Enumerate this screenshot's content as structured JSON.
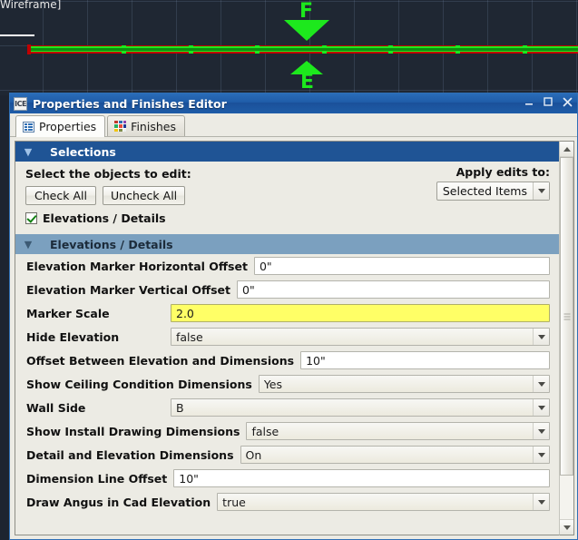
{
  "cad": {
    "status_label": "Wireframe]",
    "marker_top_letter": "F",
    "marker_bottom_letter": "E",
    "colors": {
      "background": "#1f2733",
      "grid": "#788caa",
      "wall_green": "#1de81d",
      "wall_red": "#c00000",
      "marker_green": "#1de81d"
    }
  },
  "window": {
    "app_icon_text": "ICE",
    "title": "Properties and Finishes Editor",
    "buttons": {
      "minimize": "minimize",
      "maximize": "maximize",
      "close": "close"
    },
    "accent_color": "#1f5ca8"
  },
  "tabs": [
    {
      "label": "Properties",
      "icon": "list-icon",
      "active": true
    },
    {
      "label": "Finishes",
      "icon": "color-swatch-icon",
      "active": false
    }
  ],
  "selections": {
    "header": "Selections",
    "prompt": "Select the objects to edit:",
    "check_all_label": "Check All",
    "uncheck_all_label": "Uncheck All",
    "apply_label": "Apply edits to:",
    "apply_value": "Selected Items",
    "checkbox": {
      "label": "Elevations / Details",
      "checked": true
    }
  },
  "elevations_section": {
    "header": "Elevations / Details"
  },
  "properties": [
    {
      "label": "Elevation Marker Horizontal Offset",
      "value": "0\"",
      "type": "text",
      "highlight": false,
      "label_width": 204
    },
    {
      "label": "Elevation Marker Vertical Offset",
      "value": "0\"",
      "type": "text",
      "highlight": false,
      "label_width": 189
    },
    {
      "label": "Marker Scale",
      "value": "2.0",
      "type": "text",
      "highlight": true,
      "label_width": 152
    },
    {
      "label": "Hide Elevation",
      "value": "false",
      "type": "select",
      "highlight": false,
      "label_width": 152
    },
    {
      "label": "Offset Between Elevation and Dimensions",
      "value": "10\"",
      "type": "text",
      "highlight": false,
      "label_width": 256
    },
    {
      "label": "Show Ceiling Condition Dimensions",
      "value": "Yes",
      "type": "select",
      "highlight": false,
      "label_width": 219
    },
    {
      "label": "Wall Side",
      "value": "B",
      "type": "select",
      "highlight": false,
      "label_width": 152
    },
    {
      "label": "Show Install Drawing Dimensions",
      "value": "false",
      "type": "select",
      "highlight": false,
      "label_width": 201
    },
    {
      "label": "Detail and Elevation Dimensions",
      "value": "On",
      "type": "select",
      "highlight": false,
      "label_width": 199
    },
    {
      "label": "Dimension Line Offset",
      "value": "10\"",
      "type": "text",
      "highlight": false,
      "label_width": 152
    },
    {
      "label": "Draw Angus in Cad Elevation",
      "value": "true",
      "type": "select",
      "highlight": false,
      "label_width": 177
    }
  ],
  "scrollbar": {
    "up_icon": "triangle-up-icon",
    "down_icon": "triangle-down-icon",
    "thumb_grip": "grip-dots"
  },
  "swatch_colors": [
    "#c0392b",
    "#2f6fb5",
    "#8e44ad",
    "#27ae60",
    "#e74c3c",
    "#1f3a93",
    "#f1c40f",
    "#7f8c4a",
    "#ecf0f1"
  ]
}
